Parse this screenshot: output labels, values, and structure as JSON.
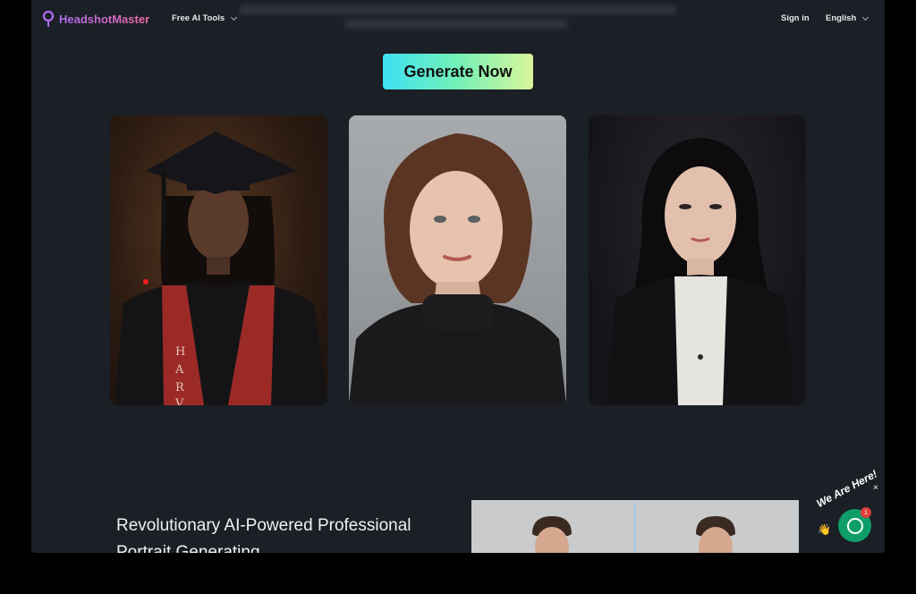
{
  "brand": {
    "name": "HeadshotMaster"
  },
  "nav": {
    "free_tools_label": "Free AI Tools",
    "signin_label": "Sign in",
    "language_label": "English"
  },
  "hero": {
    "cta_label": "Generate Now"
  },
  "gallery": {
    "cards": [
      {
        "name": "graduate-portrait"
      },
      {
        "name": "woman-black-turtleneck-portrait"
      },
      {
        "name": "woman-black-blazer-portrait"
      }
    ],
    "card1_sash_letters": "HARV"
  },
  "section": {
    "title": "Revolutionary AI-Powered Professional Portrait Generating"
  },
  "chat_widget": {
    "label": "We Are Here!",
    "unread_count": "1",
    "close_label": "×"
  },
  "colors": {
    "background": "#1b1f26",
    "cta_gradient": [
      "#3fe0f2",
      "#74f1b6",
      "#d9f59b"
    ],
    "brand_gradient": [
      "#b06cf2",
      "#ec6aa4"
    ],
    "chat_green": "#0f9e6a"
  }
}
